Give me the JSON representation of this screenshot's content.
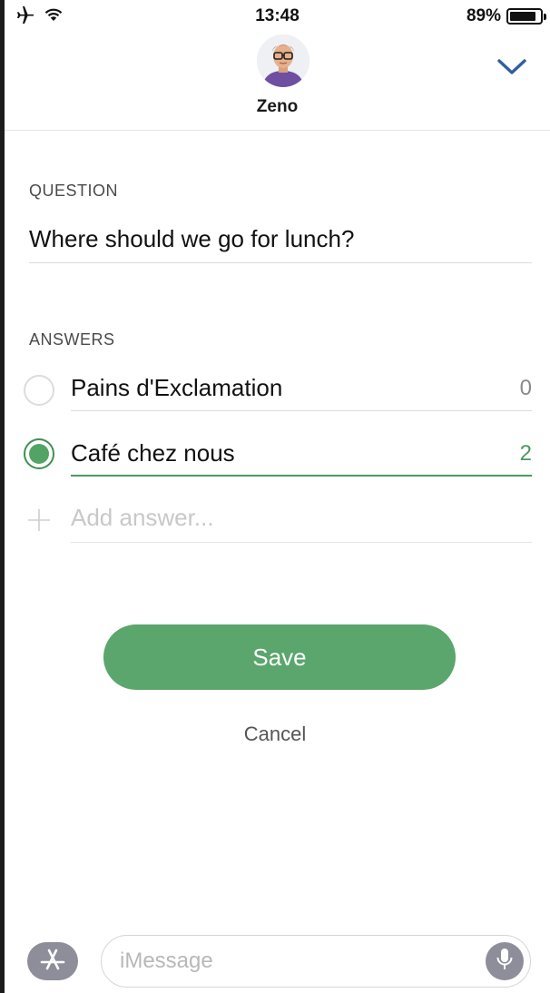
{
  "status_bar": {
    "time": "13:48",
    "battery_percent": "89%",
    "battery_level": 0.89,
    "icons": [
      "airplane-icon",
      "wifi-icon",
      "battery-icon"
    ]
  },
  "header": {
    "contact_name": "Zeno",
    "collapse_icon": "chevron-down-icon"
  },
  "question": {
    "label": "QUESTION",
    "text": "Where should we go for lunch?"
  },
  "answers": {
    "label": "ANSWERS",
    "items": [
      {
        "text": "Pains d'Exclamation",
        "count": "0",
        "selected": false
      },
      {
        "text": "Café chez nous",
        "count": "2",
        "selected": true
      }
    ],
    "add_placeholder": "Add answer..."
  },
  "actions": {
    "save_label": "Save",
    "cancel_label": "Cancel"
  },
  "imessage_bar": {
    "placeholder": "iMessage",
    "apps_icon": "app-store-icon",
    "mic_icon": "microphone-icon"
  },
  "colors": {
    "accent_green": "#5aa66c",
    "selected_green": "#4a9a5c",
    "chevron_blue": "#2f5f9f",
    "imessage_gray": "#8e8e9a"
  }
}
